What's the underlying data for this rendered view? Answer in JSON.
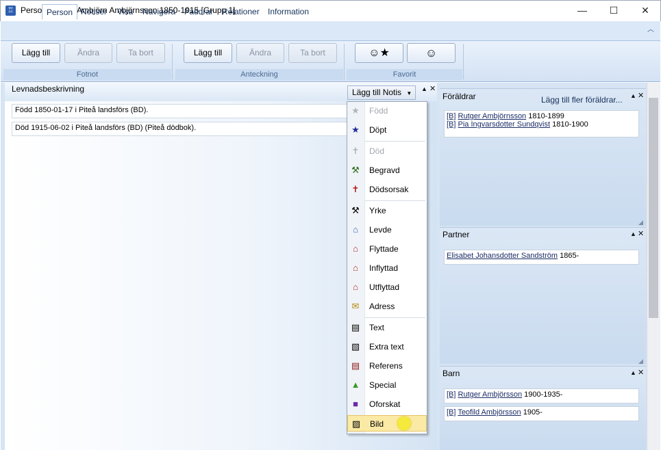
{
  "window": {
    "title": "Personöversikt Ambjörn Ambjörnsson 1850-1915 [Grupp 1]",
    "app_icon": "family-tree-icon",
    "minimize": "—",
    "maximize": "☐",
    "close": "✕"
  },
  "ribbon": {
    "tabs": [
      "Person",
      "Notiser",
      "Visa",
      "Navigera",
      "Faddrar",
      "Relationer",
      "Information"
    ],
    "active_tab": "Person",
    "collapse_icon": "chevron-up-icon",
    "groups": {
      "fotnot": {
        "label": "Fotnot",
        "add": "Lägg till",
        "edit": "Ändra",
        "remove": "Ta bort"
      },
      "anteckning": {
        "label": "Anteckning",
        "add": "Lägg till",
        "edit": "Ändra",
        "remove": "Ta bort"
      },
      "favorit": {
        "label": "Favorit",
        "star_face_icon": "star-face-icon",
        "face_icon": "face-icon"
      }
    }
  },
  "left": {
    "title": "Levnadsbeskrivning",
    "add_notis_label": "Lägg till Notis",
    "events": [
      "Född 1850-01-17 i Piteå landsförs (BD).",
      "Död 1915-06-02 i Piteå landsförs (BD) (Piteå dödbok)."
    ]
  },
  "menu": {
    "items": [
      {
        "label": "Född",
        "icon": "star-icon",
        "disabled": true
      },
      {
        "label": "Döpt",
        "icon": "star-icon",
        "disabled": false
      },
      {
        "label": "Död",
        "icon": "cross-icon",
        "disabled": true
      },
      {
        "label": "Begravd",
        "icon": "shovel-icon",
        "disabled": false
      },
      {
        "label": "Dödsorsak",
        "icon": "cross-red-icon",
        "disabled": false
      },
      {
        "label": "Yrke",
        "icon": "hammer-icon",
        "disabled": false
      },
      {
        "label": "Levde",
        "icon": "house-icon",
        "disabled": false
      },
      {
        "label": "Flyttade",
        "icon": "house-move-icon",
        "disabled": false
      },
      {
        "label": "Inflyttad",
        "icon": "house-in-icon",
        "disabled": false
      },
      {
        "label": "Utflyttad",
        "icon": "house-out-icon",
        "disabled": false
      },
      {
        "label": "Adress",
        "icon": "envelope-icon",
        "disabled": false
      },
      {
        "label": "Text",
        "icon": "text-icon",
        "disabled": false
      },
      {
        "label": "Extra text",
        "icon": "extra-text-icon",
        "disabled": false
      },
      {
        "label": "Referens",
        "icon": "reference-icon",
        "disabled": false
      },
      {
        "label": "Special",
        "icon": "warning-icon",
        "disabled": false
      },
      {
        "label": "Oforskat",
        "icon": "unresearched-icon",
        "disabled": false
      },
      {
        "label": "Bild",
        "icon": "picture-icon",
        "disabled": false,
        "highlighted": true
      }
    ]
  },
  "parents": {
    "title": "Föräldrar",
    "add_more": "Lägg till fler föräldrar...",
    "rows": [
      {
        "tag": "[B]",
        "name": "Rutger Ambjörnsson",
        "years": "1810-1899"
      },
      {
        "tag": "[B]",
        "name": "Pia Ingvarsdotter Sundqvist",
        "years": "1810-1900"
      }
    ]
  },
  "partner": {
    "title": "Partner",
    "rows": [
      {
        "name": "Elisabet Johansdotter Sandström",
        "years": "1865-"
      }
    ]
  },
  "children": {
    "title": "Barn",
    "rows": [
      {
        "tag": "[B]",
        "name": "Rutger Ambjörsson",
        "years": "1900-1935-"
      },
      {
        "tag": "[B]",
        "name": "Teofild Ambjörsson",
        "years": "1905-"
      }
    ]
  },
  "panel_controls": {
    "up": "▲",
    "close": "✕"
  },
  "colors": {
    "accent": "#2f5fb0",
    "highlight": "#fbeaa6",
    "ribbon": "#dbe8f7"
  }
}
